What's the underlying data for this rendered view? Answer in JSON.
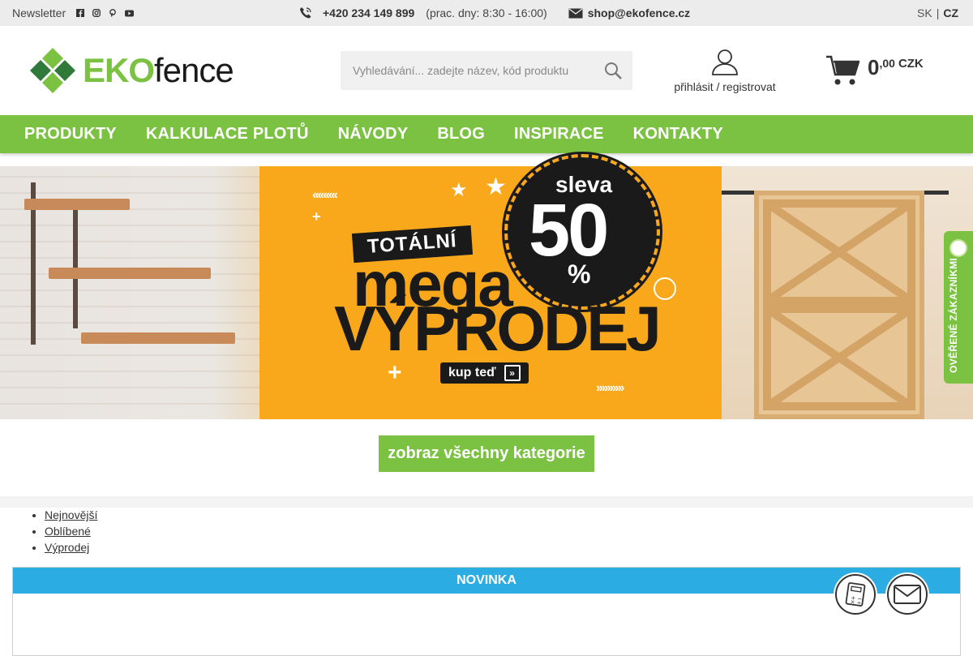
{
  "topbar": {
    "newsletter": "Newsletter",
    "social_icons": [
      "facebook-icon",
      "instagram-icon",
      "pinterest-icon",
      "youtube-icon"
    ],
    "phone": "+420 234 149 899",
    "hours": "(prac. dny: 8:30 - 16:00)",
    "email": "shop@ekofence.cz",
    "lang_sk": "SK",
    "lang_sep": "|",
    "lang_cz": "CZ"
  },
  "header": {
    "logo_eko": "EKO",
    "logo_fence": "fence",
    "search_placeholder": "Vyhledávání... zadejte název, kód produktu",
    "account_label": "přihlásit / registrovat",
    "cart_int": "0",
    "cart_dec": ",00",
    "cart_currency": "CZK"
  },
  "nav": {
    "items": [
      "PRODUKTY",
      "KALKULACE PLOTŮ",
      "NÁVODY",
      "BLOG",
      "INSPIRACE",
      "KONTAKTY"
    ]
  },
  "banner": {
    "sleva": "sleva",
    "percent_num": "50",
    "percent_sign": "%",
    "totalni": "TOTÁLNÍ",
    "mega": "mega",
    "vyprodej": "VÝPRODEJ",
    "cta": "kup teď"
  },
  "verified_badge": "OVĚŘENÉ ZÁKAZNÍKMI",
  "categories_button": "zobraz všechny kategorie",
  "tabs": [
    "Nejnovější",
    "Oblíbené",
    "Výprodej"
  ],
  "product_section": {
    "header": "NOVINKA"
  },
  "colors": {
    "brand_green": "#7bc142",
    "novinka_blue": "#2bace2",
    "banner_orange": "#f9a71b"
  }
}
